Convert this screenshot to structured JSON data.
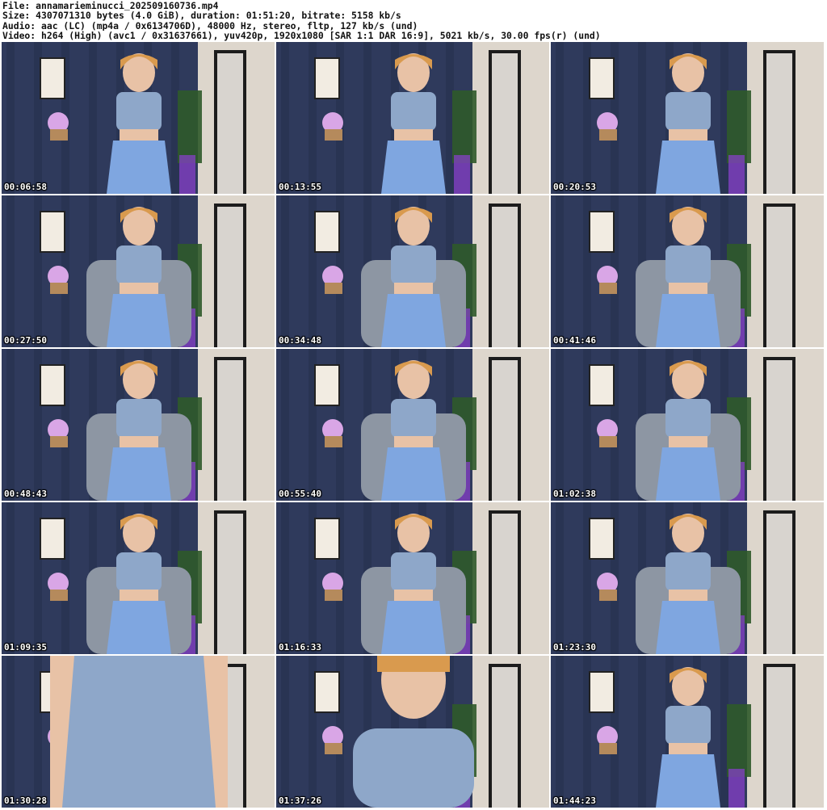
{
  "header": {
    "file": "File: annamarieminucci_202509160736.mp4",
    "size": "Size: 4307071310 bytes (4.0 GiB), duration: 01:51:20, bitrate: 5158 kb/s",
    "audio": "Audio: aac (LC) (mp4a / 0x6134706D), 48000 Hz, stereo, fltp, 127 kb/s (und)",
    "video": "Video: h264 (High) (avc1 / 0x31637661), yuv420p, 1920x1080 [SAR 1:1 DAR 16:9], 5021 kb/s, 30.00 fps(r) (und)"
  },
  "frames": [
    {
      "timestamp": "00:06:58",
      "scene": "standing-closeup"
    },
    {
      "timestamp": "00:13:55",
      "scene": "standing-full"
    },
    {
      "timestamp": "00:20:53",
      "scene": "standing-full"
    },
    {
      "timestamp": "00:27:50",
      "scene": "seated-wide"
    },
    {
      "timestamp": "00:34:48",
      "scene": "seated-wide"
    },
    {
      "timestamp": "00:41:46",
      "scene": "seated"
    },
    {
      "timestamp": "00:48:43",
      "scene": "seated"
    },
    {
      "timestamp": "00:55:40",
      "scene": "seated"
    },
    {
      "timestamp": "01:02:38",
      "scene": "seated"
    },
    {
      "timestamp": "01:09:35",
      "scene": "seated"
    },
    {
      "timestamp": "01:16:33",
      "scene": "seated-closeup"
    },
    {
      "timestamp": "01:23:30",
      "scene": "seated"
    },
    {
      "timestamp": "01:30:28",
      "scene": "torso-closeup"
    },
    {
      "timestamp": "01:37:26",
      "scene": "face-closeup"
    },
    {
      "timestamp": "01:44:23",
      "scene": "standing-full"
    }
  ],
  "colors": {
    "curtain": "#2f3a5c",
    "top": "#8ea7c9",
    "skirt": "#7fa6e0",
    "skin": "#e8c2a6",
    "hair": "#d99a4e",
    "wall": "#ddd6cc",
    "chair": "#8d96a3",
    "plant": "#2f5a2a",
    "purple": "#8b3fd0"
  }
}
